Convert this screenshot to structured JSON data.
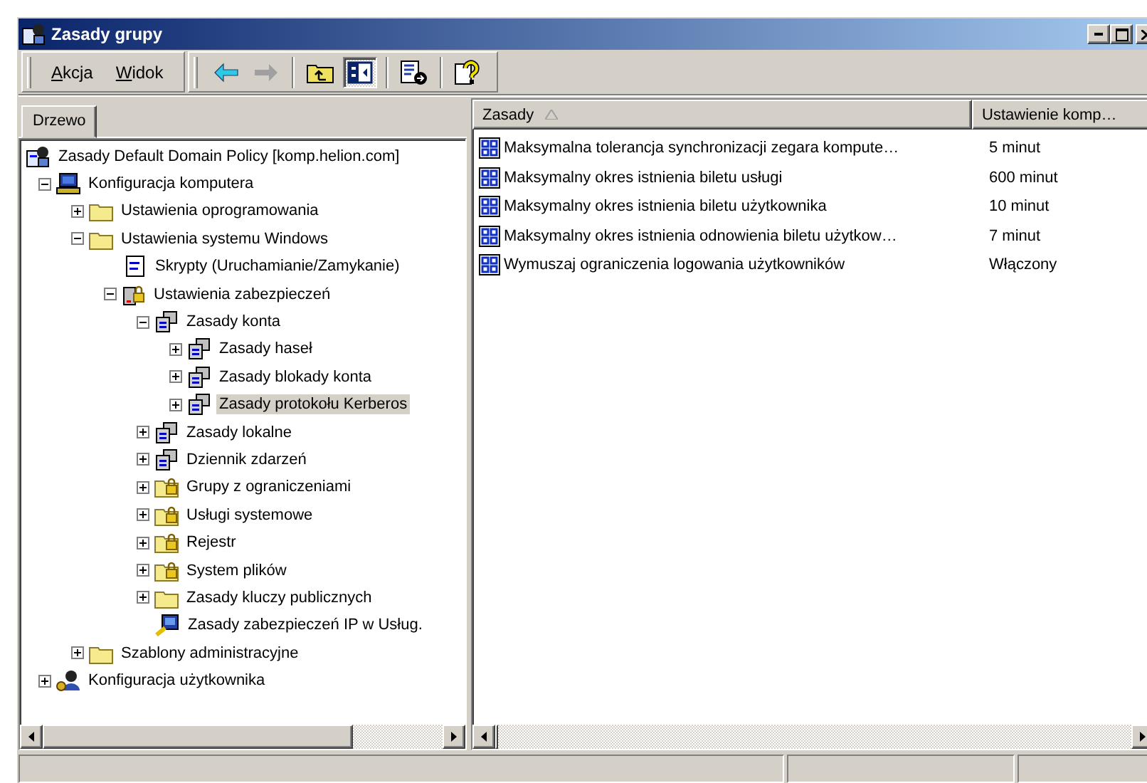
{
  "window": {
    "title": "Zasady grupy"
  },
  "menu": [
    {
      "label": "Akcja"
    },
    {
      "label": "Widok"
    }
  ],
  "toolbar": [
    {
      "kind": "back",
      "disabled": false,
      "pressed": false
    },
    {
      "kind": "forward",
      "disabled": true,
      "pressed": false
    },
    {
      "kind": "up",
      "disabled": false,
      "pressed": false
    },
    {
      "kind": "tree-toggle",
      "disabled": false,
      "pressed": true
    },
    {
      "kind": "export",
      "disabled": false,
      "pressed": false
    },
    {
      "kind": "help",
      "disabled": false,
      "pressed": false
    }
  ],
  "tabs": [
    {
      "label": "Drzewo",
      "selected": true
    }
  ],
  "tree": [
    {
      "label": "Zasady Default Domain Policy [komp.helion.com]",
      "kind": "policy",
      "selected": false,
      "children": [
        {
          "label": "Konfiguracja komputera",
          "kind": "computer",
          "expanded": true,
          "selected": false,
          "children": [
            {
              "label": "Ustawienia oprogramowania",
              "kind": "folder",
              "expanded": false,
              "selected": false
            },
            {
              "label": "Ustawienia systemu Windows",
              "kind": "folder",
              "expanded": true,
              "selected": false,
              "children": [
                {
                  "label": "Skrypty (Uruchamianie/Zamykanie)",
                  "kind": "script",
                  "selected": false
                },
                {
                  "label": "Ustawienia zabezpieczeń",
                  "kind": "lock-server",
                  "expanded": true,
                  "selected": false,
                  "children": [
                    {
                      "label": "Zasady konta",
                      "kind": "servers",
                      "expanded": true,
                      "selected": false,
                      "children": [
                        {
                          "label": "Zasady haseł",
                          "kind": "servers",
                          "expanded": false,
                          "selected": false
                        },
                        {
                          "label": "Zasady blokady konta",
                          "kind": "servers",
                          "expanded": false,
                          "selected": false
                        },
                        {
                          "label": "Zasady protokołu Kerberos",
                          "kind": "servers",
                          "expanded": false,
                          "selected": true
                        }
                      ]
                    },
                    {
                      "label": "Zasady lokalne",
                      "kind": "servers",
                      "expanded": false,
                      "selected": false
                    },
                    {
                      "label": "Dziennik zdarzeń",
                      "kind": "servers",
                      "expanded": false,
                      "selected": false
                    },
                    {
                      "label": "Grupy z ograniczeniami",
                      "kind": "lock-folder",
                      "expanded": false,
                      "selected": false
                    },
                    {
                      "label": "Usługi systemowe",
                      "kind": "lock-folder",
                      "expanded": false,
                      "selected": false
                    },
                    {
                      "label": "Rejestr",
                      "kind": "lock-folder",
                      "expanded": false,
                      "selected": false
                    },
                    {
                      "label": "System plików",
                      "kind": "lock-folder",
                      "expanded": false,
                      "selected": false
                    },
                    {
                      "label": "Zasady kluczy publicznych",
                      "kind": "folder",
                      "expanded": false,
                      "selected": false
                    },
                    {
                      "label": "Zasady zabezpieczeń IP w Usług.",
                      "kind": "ip",
                      "selected": false
                    }
                  ]
                }
              ]
            },
            {
              "label": "Szablony administracyjne",
              "kind": "folder",
              "expanded": false,
              "selected": false
            }
          ]
        },
        {
          "label": "Konfiguracja użytkownika",
          "kind": "user",
          "expanded": false,
          "selected": false
        }
      ]
    }
  ],
  "table": {
    "columns": [
      {
        "label": "Zasady",
        "sorted": true
      },
      {
        "label": "Ustawienie komp…",
        "sorted": false
      }
    ],
    "rows": [
      {
        "policy": "Maksymalna tolerancja synchronizacji zegara kompute…",
        "setting": "5 minut"
      },
      {
        "policy": "Maksymalny okres istnienia biletu usługi",
        "setting": "600 minut"
      },
      {
        "policy": "Maksymalny okres istnienia biletu użytkownika",
        "setting": "10 minut"
      },
      {
        "policy": "Maksymalny okres istnienia odnowienia biletu użytkow…",
        "setting": "7 minut"
      },
      {
        "policy": "Wymuszaj ograniczenia logowania użytkowników",
        "setting": "Włączony"
      }
    ]
  }
}
